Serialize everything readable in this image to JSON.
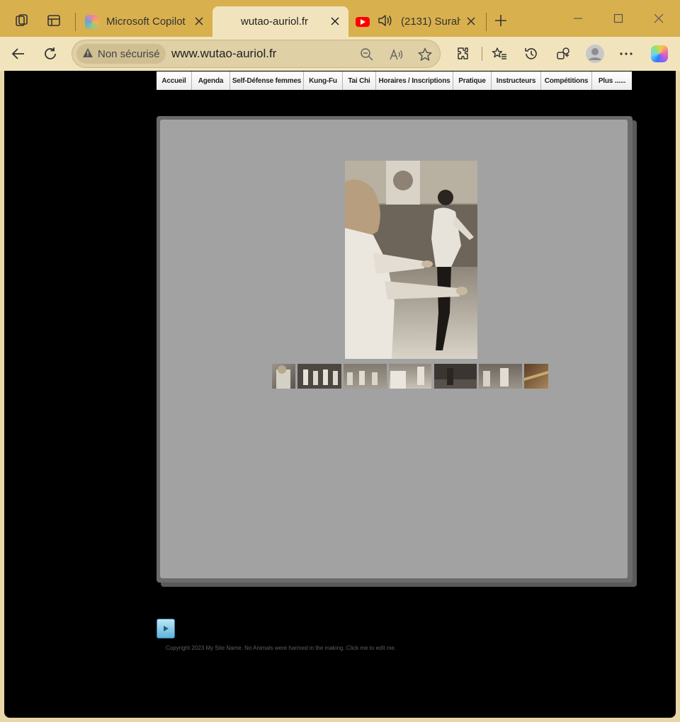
{
  "browser": {
    "tabs": [
      {
        "title": "Microsoft Copilot",
        "icon": "copilot-icon",
        "active": false
      },
      {
        "title": "wutao-auriol.fr",
        "icon": "none",
        "active": true
      },
      {
        "title": "(2131) Surah",
        "icon": "youtube-icon",
        "active": false
      }
    ],
    "address": {
      "security_label": "Non sécurisé",
      "url": "www.wutao-auriol.fr"
    }
  },
  "site": {
    "menu": [
      "Accueil",
      "Agenda",
      "Self-Défense femmes",
      "Kung-Fu",
      "Tai Chi",
      "Horaires / Inscriptions",
      "Pratique",
      "Instructeurs",
      "Compétitions",
      "Plus ......"
    ],
    "gallery": {
      "thumbnail_count": 7
    },
    "footer": {
      "copyright": "Copyright 2023 My Site Name. No Animals were harmed in the making. Click me to edit me."
    }
  },
  "colors": {
    "tabstrip": "#d9b04e",
    "toolbar": "#f1e4bd",
    "page_background": "#000000",
    "panel": "#a2a2a2",
    "youtube_red": "#ff0000"
  }
}
